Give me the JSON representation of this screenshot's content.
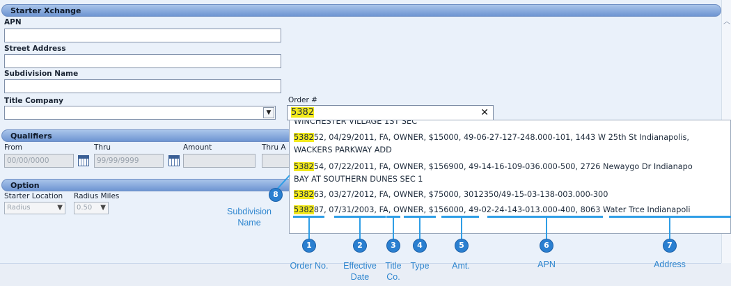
{
  "panel": {
    "title": "Starter Xchange"
  },
  "fields": {
    "apn_label": "APN",
    "street_label": "Street Address",
    "subdivision_label": "Subdivision Name",
    "title_company_label": "Title Company",
    "order_label": "Order #",
    "order_value_highlight": "5382"
  },
  "qualifiers": {
    "header": "Qualifiers",
    "from_label": "From",
    "from_value": "00/00/0000",
    "thru_label": "Thru",
    "thru_value": "99/99/9999",
    "amount_label": "Amount",
    "thru_amount_label": "Thru A"
  },
  "option": {
    "header": "Option",
    "starter_location_label": "Starter Location",
    "starter_location_value": "Radius",
    "radius_miles_label": "Radius Miles",
    "radius_miles_value": "0.50"
  },
  "dropdown": {
    "lines": [
      {
        "hl": "",
        "rest": "WINCHESTER VILLAGE 1ST SEC"
      },
      {
        "hl": "5382",
        "rest": "52, 04/29/2011, FA, OWNER, $15000, 49-06-27-127-248.000-101, 1443 W 25th St Indianapolis,"
      },
      {
        "hl": "",
        "rest": "WACKERS PARKWAY ADD"
      },
      {
        "hl": "5382",
        "rest": "54, 07/22/2011, FA, OWNER, $156900, 49-14-16-109-036.000-500, 2726 Newaygo Dr Indianapo"
      },
      {
        "hl": "",
        "rest": "BAY AT SOUTHERN DUNES SEC 1"
      },
      {
        "hl": "5382",
        "rest": "63, 03/27/2012, FA, OWNER, $75000, 3012350/49-15-03-138-003.000-300"
      },
      {
        "hl": "5382",
        "rest": "87, 07/31/2003, FA, OWNER, $156000, 49-02-24-143-013.000-400, 8063 Water Trce Indianapoli"
      }
    ]
  },
  "callouts": [
    {
      "num": "1",
      "label": "Order No."
    },
    {
      "num": "2",
      "label": "Effective Date"
    },
    {
      "num": "3",
      "label": "Title Co."
    },
    {
      "num": "4",
      "label": "Type"
    },
    {
      "num": "5",
      "label": "Amt."
    },
    {
      "num": "6",
      "label": "APN"
    },
    {
      "num": "7",
      "label": "Address"
    },
    {
      "num": "8",
      "label": "Subdivision Name"
    }
  ],
  "icons": {
    "clear": "✕",
    "select_caret": "▼",
    "scroll_up": "︿"
  }
}
